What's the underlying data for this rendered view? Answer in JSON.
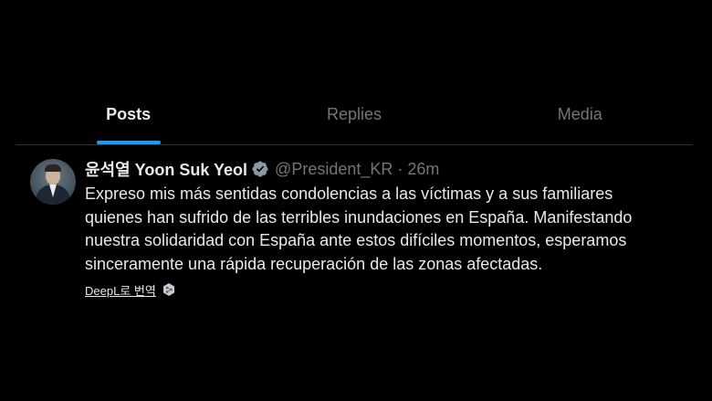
{
  "tabs": [
    {
      "label": "Posts",
      "active": true
    },
    {
      "label": "Replies",
      "active": false
    },
    {
      "label": "Media",
      "active": false
    }
  ],
  "tweet": {
    "avatar_icon": "user-avatar",
    "display_name": "윤석열 Yoon Suk Yeol",
    "verified_icon": "verified-badge-icon",
    "handle": "@President_KR",
    "separator": "·",
    "time": "26m",
    "more_icon": "more-options-icon",
    "text": "Expreso mis más sentidas condolencias a las víctimas y a sus familiares quienes han sufrido de las terribles inundaciones en España. Manifestando nuestra solidaridad con España ante estos difíciles momentos, esperamos sinceramente una rápida recuperación de las zonas afectadas.",
    "translate_label": "DeepL로 번역",
    "translate_icon": "deepl-icon"
  },
  "colors": {
    "background": "#000000",
    "text_primary": "#e7e9ea",
    "text_secondary": "#71767b",
    "accent": "#1d9bf0",
    "border": "#2f3336"
  }
}
